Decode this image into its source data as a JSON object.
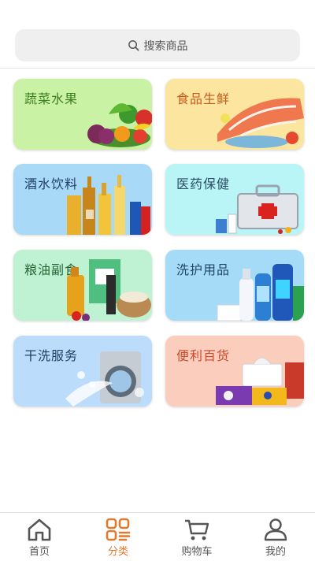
{
  "search": {
    "placeholder": "搜索商品"
  },
  "categories": [
    {
      "label": "蔬菜水果",
      "bg": "#c9f2a4",
      "color": "#3f7d1e"
    },
    {
      "label": "食品生鲜",
      "bg": "#fbe59f",
      "color": "#c85b1f"
    },
    {
      "label": "酒水饮料",
      "bg": "#a8daf7",
      "color": "#1f3f66"
    },
    {
      "label": "医药保健",
      "bg": "#b9f4f7",
      "color": "#2b4e63"
    },
    {
      "label": "粮油副食",
      "bg": "#bef2d3",
      "color": "#2a6234"
    },
    {
      "label": "洗护用品",
      "bg": "#a6dbf7",
      "color": "#1f4766"
    },
    {
      "label": "干洗服务",
      "bg": "#bcdcfb",
      "color": "#1f3f66"
    },
    {
      "label": "便利百货",
      "bg": "#fbcdbd",
      "color": "#c84a2a"
    }
  ],
  "tabs": [
    {
      "label": "首页"
    },
    {
      "label": "分类"
    },
    {
      "label": "购物车"
    },
    {
      "label": "我的"
    }
  ],
  "colors": {
    "accent": "#e07a2e",
    "inactive": "#555555"
  }
}
